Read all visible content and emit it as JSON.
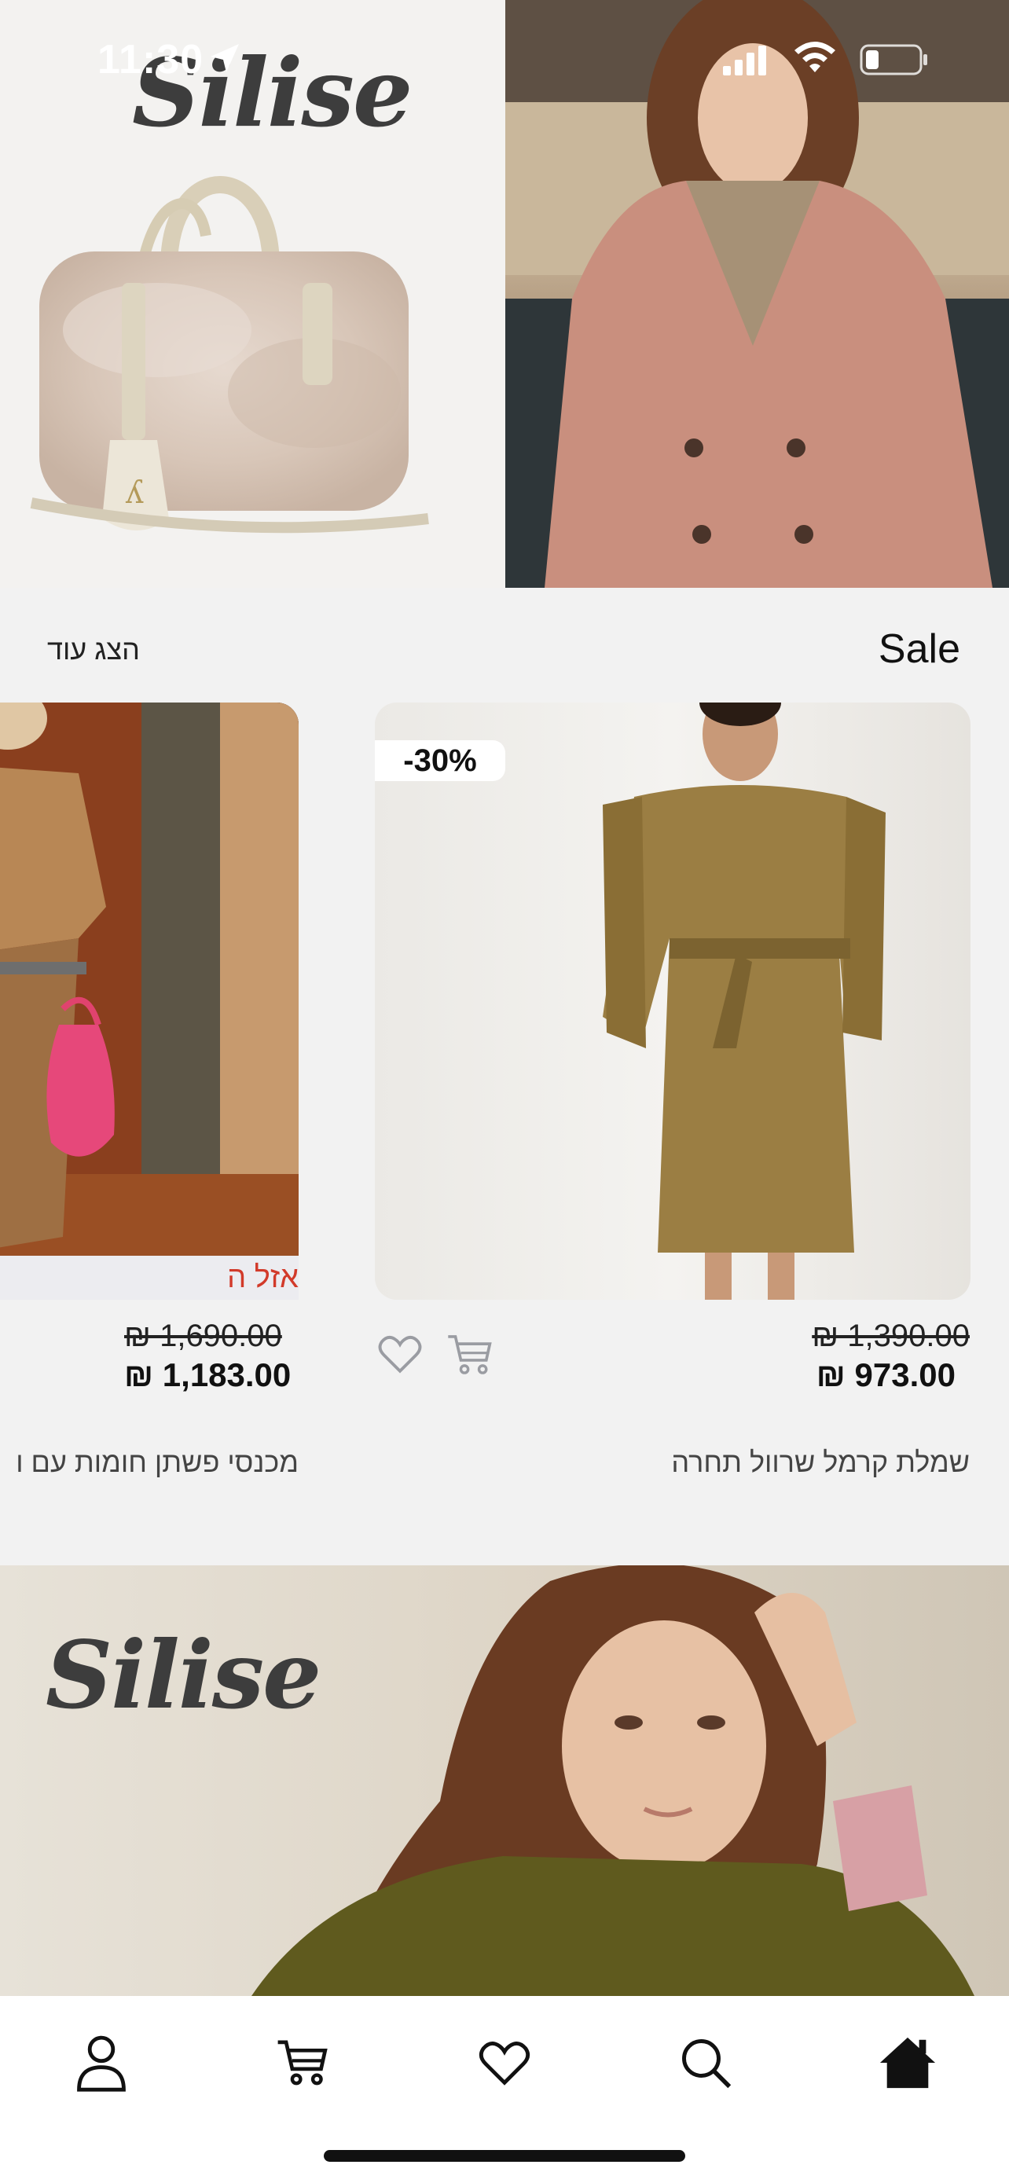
{
  "status_bar": {
    "time": "11:30",
    "icons": [
      "location-arrow-icon",
      "cellular-signal-icon",
      "wifi-icon",
      "battery-icon"
    ]
  },
  "hero": {
    "logo": "Silise",
    "left_image": "faux-fur-handbag",
    "right_image": "woman-in-pink-coat"
  },
  "sale_section": {
    "title": "Sale",
    "show_more": "הצג עוד",
    "products": [
      {
        "discount_badge": "-30%",
        "old_price": "₪ 1,390.00",
        "new_price": "₪ 973.00",
        "name": "שמלת קרמל שרוול תחרה",
        "image": "olive-dress-lace-sleeves",
        "actions": [
          "heart-icon",
          "cart-icon"
        ]
      },
      {
        "sale_label": "אזל ה",
        "old_price": "₪ 1,690.00",
        "new_price": "₪ 1,183.00",
        "name": "מכנסי פשתן חומות עם ו",
        "image": "linen-outfit-pink-bag"
      }
    ]
  },
  "banner2": {
    "logo": "Silise",
    "image": "woman-in-olive-sweater"
  },
  "bottom_nav": {
    "items": [
      "profile-icon",
      "cart-icon",
      "heart-icon",
      "search-icon",
      "home-icon"
    ],
    "active": "home-icon"
  },
  "colors": {
    "background": "#f2f2f2",
    "sale_red": "#d23a2a",
    "text": "#111111"
  }
}
